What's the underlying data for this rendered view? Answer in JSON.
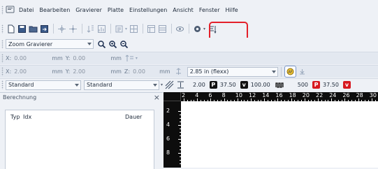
{
  "menu": {
    "items": [
      "Datei",
      "Bearbeiten",
      "Gravierer",
      "Platte",
      "Einstellungen",
      "Ansicht",
      "Fenster",
      "Hilfe"
    ]
  },
  "toolbar": {
    "highlight_color": "#e3202a"
  },
  "zoom": {
    "value": "Zoom Gravierer"
  },
  "coords1": {
    "x_label": "X:",
    "x_value": "0.00",
    "x_unit": "mm",
    "y_label": "Y:",
    "y_value": "0.00",
    "y_unit": "mm"
  },
  "coords2": {
    "x_label": "X:",
    "x_value": "2.00",
    "x_unit": "mm",
    "y_label": "Y:",
    "y_value": "2.00",
    "y_unit": "mm",
    "z_label": "Z:",
    "z_value": "0.00",
    "z_unit": "mm",
    "flex_value": "2.85 in (flexx)"
  },
  "params": {
    "preset1": "Standard",
    "preset2": "Standard",
    "depth": "2.00",
    "p_label": "P",
    "p_value": "37.50",
    "v_label": "v",
    "v_value": "100.00",
    "w_value": "500",
    "p2_label": "P",
    "p2_value": "37.50",
    "v2_label": "v"
  },
  "panel": {
    "title": "Berechnung",
    "close": "×",
    "col_typ": "Typ",
    "col_idx": "Idx",
    "col_dauer": "Dauer"
  },
  "ruler": {
    "h_ticks": [
      "2",
      "4",
      "6",
      "8",
      "10",
      "12",
      "14",
      "16",
      "18",
      "20",
      "22",
      "24",
      "26",
      "28",
      "30"
    ],
    "v_ticks": [
      "2",
      "4",
      "6",
      "8"
    ]
  }
}
